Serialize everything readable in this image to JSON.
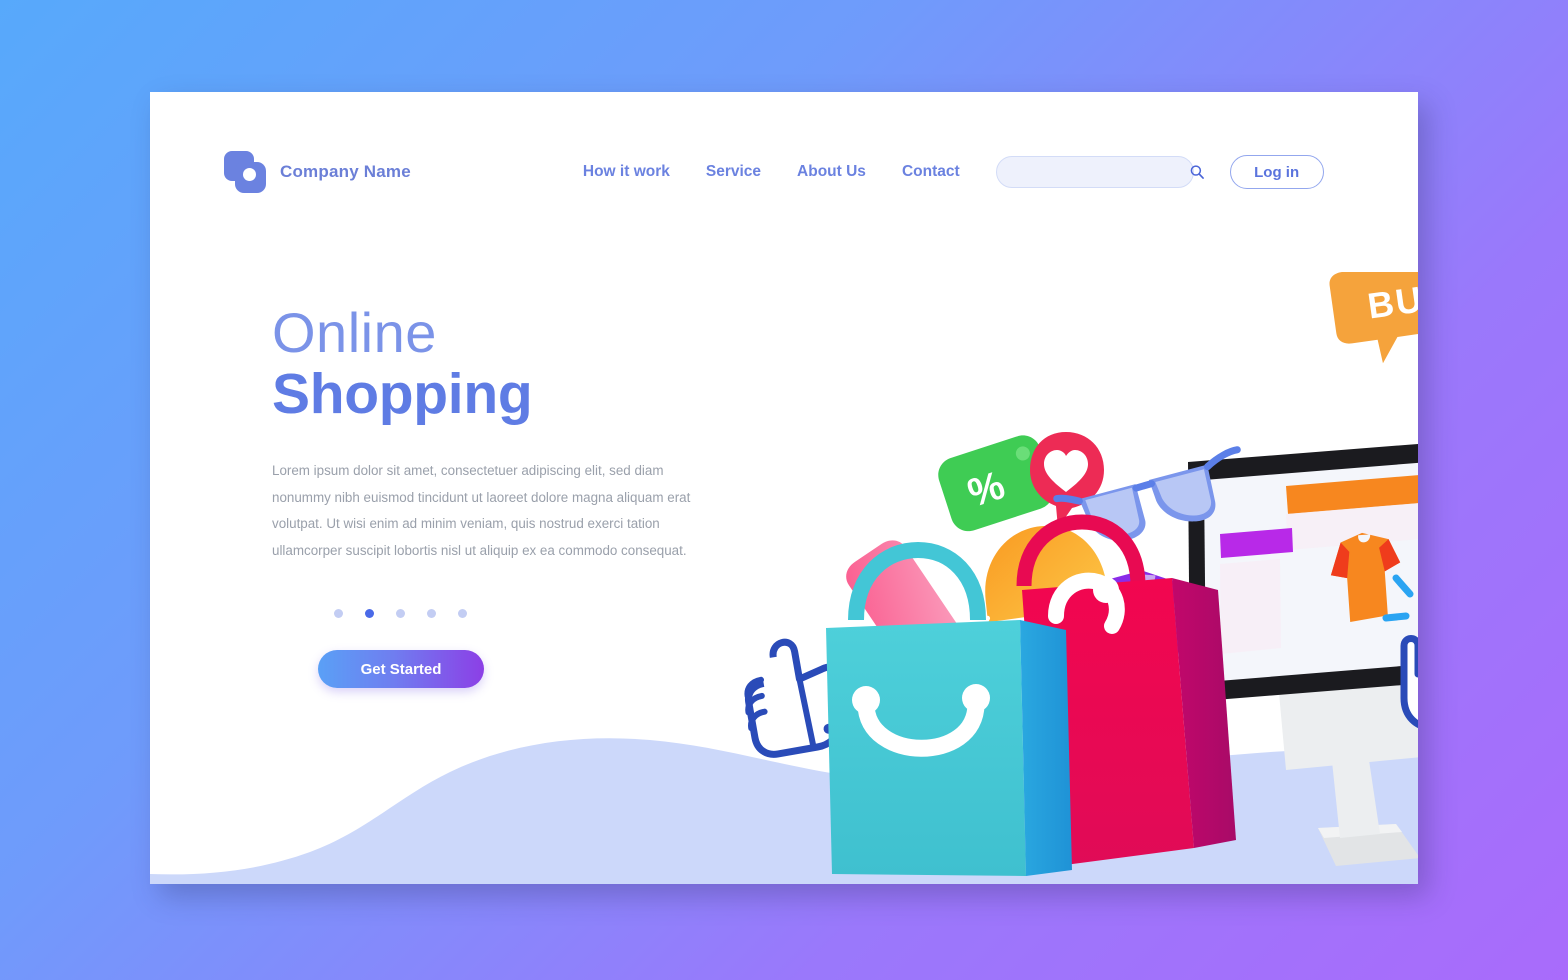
{
  "page": {
    "background_gradient_from": "#57a9fb",
    "background_gradient_to": "#a96bfb",
    "card_background": "#ffffff"
  },
  "header": {
    "brand_name": "Company Name",
    "logo_icon": "stacked-squares-logo-icon",
    "logo_color": "#6b82e0",
    "nav": [
      {
        "label": "How it work"
      },
      {
        "label": "Service"
      },
      {
        "label": "About Us"
      },
      {
        "label": "Contact"
      }
    ],
    "search": {
      "value": "",
      "placeholder": "",
      "icon": "search-icon",
      "field_color": "#eef1fc"
    },
    "login_label": "Log in",
    "nav_color": "#6b82e0"
  },
  "hero": {
    "title_line1": "Online",
    "title_line2": "Shopping",
    "title_color_light": "#7b93e8",
    "title_color_bold": "#5f7ce4",
    "paragraph": "Lorem ipsum dolor sit amet, consectetuer adipiscing elit, sed diam nonummy nibh euismod tincidunt ut laoreet dolore magna aliquam erat volutpat. Ut wisi enim ad minim veniam, quis nostrud exerci tation ullamcorper suscipit lobortis nisl ut aliquip ex ea commodo consequat.",
    "paragraph_color": "#9aa0ab",
    "carousel": {
      "total": 5,
      "active_index": 1,
      "active_color": "#4a6ae8",
      "inactive_color": "#c3cdf3"
    },
    "cta_label": "Get Started",
    "cta_gradient_from": "#5aa0f6",
    "cta_gradient_to": "#8c3fe6"
  },
  "illustration": {
    "name": "online-shopping-illustration",
    "buy_label": "BUY",
    "buy_badge_color": "#f5a33c",
    "percent_label": "%",
    "discount_tag_color": "#3fcc54",
    "heart_bubble_color": "#ed2b55",
    "sunglasses_color": "#5b7fe8",
    "cap_color": "#f9a42e",
    "shoe_color": "#f95d8c",
    "tshirt_float_color": "#8a2be8",
    "bag_teal_color": "#43c6d6",
    "bag_crimson_color": "#e80a52",
    "monitor_frame_color": "#1b1b1f",
    "monitor_stand_color": "#e9eaec",
    "screen_tshirt_color": "#f7871f",
    "screen_header_color": "#f7871f",
    "screen_accent_color": "#b829e8",
    "cursor_color": "#2a4bb8",
    "thumbsup_color": "#2a4bb8",
    "wave_color": "#ccd8fa"
  }
}
